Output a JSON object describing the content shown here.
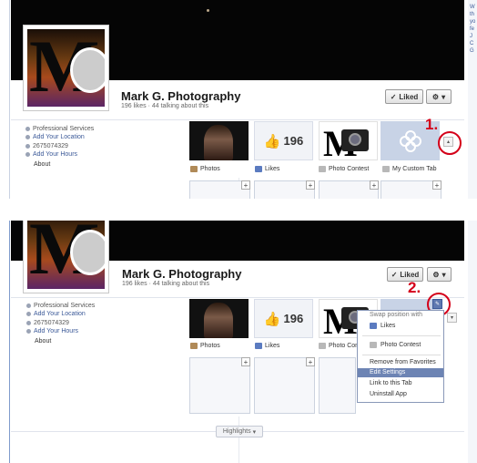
{
  "page": {
    "name": "Mark G. Photography",
    "stats": "196 likes · 44 talking about this",
    "liked_label": "Liked",
    "liked_check": "✓",
    "gear_caret": "▾",
    "info": {
      "category": "Professional Services",
      "location": "Add Your Location",
      "phone": "2675074329",
      "hours": "Add Your Hours",
      "about": "About"
    },
    "apps": [
      {
        "label": "Photos",
        "icon_color": "#b08a58"
      },
      {
        "label": "Likes",
        "icon_color": "#5b7bc0",
        "count": "196"
      },
      {
        "label": "Photo Contest",
        "icon_color": "#b8b8b8"
      },
      {
        "label": "My Custom Tab",
        "icon_color": "#b8b8b8"
      }
    ],
    "plus": "+",
    "edit_caret": "▴",
    "menu_caret": "▾"
  },
  "edit_menu": {
    "header": "Swap position with",
    "swap_items": [
      "Likes",
      "Photo Contest"
    ],
    "actions": [
      "Remove from Favorites",
      "Edit Settings",
      "Link to this Tab",
      "Uninstall App"
    ],
    "selected": "Edit Settings",
    "pencil": "✎"
  },
  "highlights": {
    "label": "Highlights",
    "caret": "▾"
  },
  "annotations": [
    "1.",
    "2."
  ],
  "colors": {
    "annotation": "#d40019",
    "link": "#3b5998",
    "menu_highlight": "#6d84b4"
  },
  "right_edge_text": [
    "W",
    "th",
    "yo",
    "fe",
    "J",
    "C",
    "G"
  ]
}
